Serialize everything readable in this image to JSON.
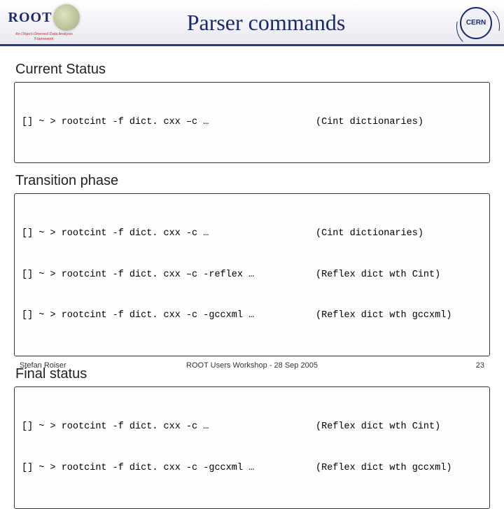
{
  "header": {
    "root_word": "ROOT",
    "root_tagline": "An Object-Oriented Data Analysis Framework",
    "title": "Parser commands",
    "cern_label": "CERN"
  },
  "sections": [
    {
      "heading": "Current Status",
      "lines": [
        {
          "cmd": "[] ~ > rootcint -f dict. cxx –c …",
          "desc": "(Cint dictionaries)"
        }
      ]
    },
    {
      "heading": "Transition phase",
      "lines": [
        {
          "cmd": "[] ~ > rootcint -f dict. cxx -c …",
          "desc": "(Cint dictionaries)"
        },
        {
          "cmd": "[] ~ > rootcint -f dict. cxx –c -reflex …",
          "desc": "(Reflex dict wth Cint)"
        },
        {
          "cmd": "[] ~ > rootcint -f dict. cxx -c -gccxml …",
          "desc": "(Reflex dict wth gccxml)"
        }
      ]
    },
    {
      "heading": "Final status",
      "lines": [
        {
          "cmd": "[] ~ > rootcint -f dict. cxx -c …",
          "desc": "(Reflex dict wth Cint)"
        },
        {
          "cmd": "[] ~ > rootcint -f dict. cxx -c -gccxml …",
          "desc": "(Reflex dict wth gccxml)"
        }
      ]
    }
  ],
  "footer": {
    "author": "Stefan Roiser",
    "event": "ROOT Users Workshop  -  28 Sep 2005",
    "page": "23"
  }
}
